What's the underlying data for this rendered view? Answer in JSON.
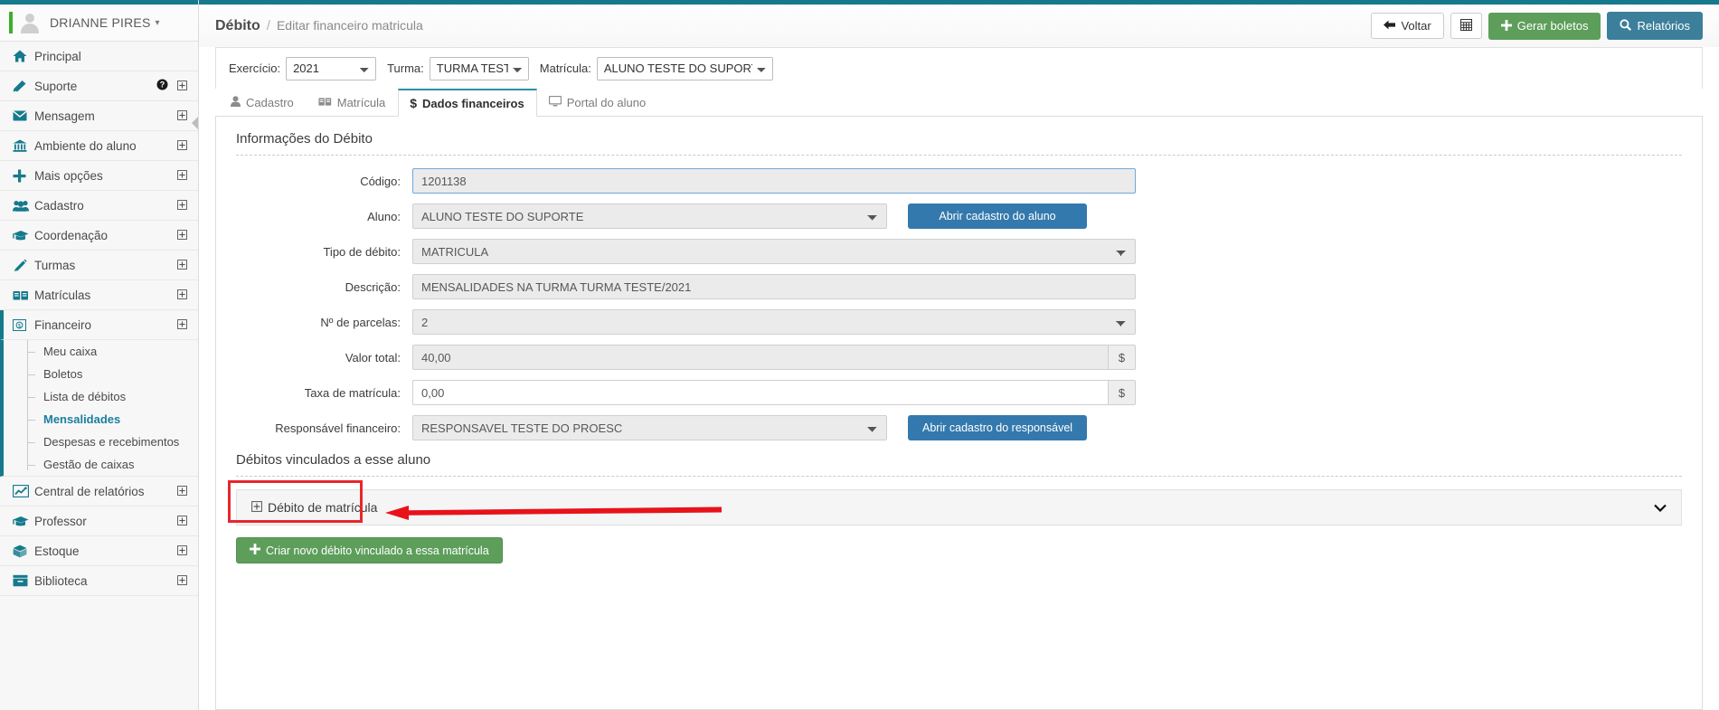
{
  "sidebar": {
    "user": {
      "name": "DRIANNE PIRES",
      "caret": "chevron-down"
    },
    "items": [
      {
        "label": "Principal",
        "icon": "home-icon",
        "expand": ""
      },
      {
        "label": "Suporte",
        "icon": "support-icon",
        "expand": "⊞",
        "help": "?"
      },
      {
        "label": "Mensagem",
        "icon": "envelope-icon",
        "expand": "⊞"
      },
      {
        "label": "Ambiente do aluno",
        "icon": "bank-icon",
        "expand": "⊞"
      },
      {
        "label": "Mais opções",
        "icon": "plus-icon",
        "expand": "⊞"
      },
      {
        "label": "Cadastro",
        "icon": "users-icon",
        "expand": "⊞"
      },
      {
        "label": "Coordenação",
        "icon": "graduation-icon",
        "expand": "⊞"
      },
      {
        "label": "Turmas",
        "icon": "pencil-icon",
        "expand": "⊞"
      },
      {
        "label": "Matrículas",
        "icon": "book-icon",
        "expand": "⊞"
      }
    ],
    "financeiro": {
      "label": "Financeiro",
      "icon": "money-circle-icon",
      "expand": "⊞"
    },
    "financeiro_sub": [
      {
        "label": "Meu caixa",
        "selected": false
      },
      {
        "label": "Boletos",
        "selected": false
      },
      {
        "label": "Lista de débitos",
        "selected": false
      },
      {
        "label": "Mensalidades",
        "selected": true
      },
      {
        "label": "Despesas e recebimentos",
        "selected": false
      },
      {
        "label": "Gestão de caixas",
        "selected": false
      }
    ],
    "items_after": [
      {
        "label": "Central de relatórios",
        "icon": "chart-icon",
        "expand": "⊞"
      },
      {
        "label": "Professor",
        "icon": "graduation-icon",
        "expand": "⊞"
      },
      {
        "label": "Estoque",
        "icon": "box-icon",
        "expand": "⊞"
      },
      {
        "label": "Biblioteca",
        "icon": "library-icon",
        "expand": "⊞"
      }
    ]
  },
  "header": {
    "breadcrumb_main": "Débito",
    "breadcrumb_sep": "/",
    "breadcrumb_sub": "Editar financeiro matricula",
    "buttons": {
      "voltar": "Voltar",
      "voltar_icon": "arrow-left-icon",
      "grid_icon": "grid-icon",
      "gerar_boletos": "Gerar boletos",
      "gerar_boletos_icon": "plus-icon",
      "relatorios": "Relatórios",
      "relatorios_icon": "search-icon"
    }
  },
  "filters": {
    "exercicio_label": "Exercício:",
    "exercicio_value": "2021",
    "turma_label": "Turma:",
    "turma_value": "TURMA TESTE",
    "matricula_label": "Matrícula:",
    "matricula_value": "ALUNO TESTE DO SUPORTE"
  },
  "tabs": [
    {
      "label": "Cadastro",
      "icon": "user-icon",
      "active": false
    },
    {
      "label": "Matrícula",
      "icon": "book-icon",
      "active": false
    },
    {
      "label": "Dados financeiros",
      "icon": "dollar-icon",
      "active": true
    },
    {
      "label": "Portal do aluno",
      "icon": "monitor-icon",
      "active": false
    }
  ],
  "form": {
    "section_title": "Informações do Débito",
    "fields": [
      {
        "label": "Código:",
        "value": "1201138"
      },
      {
        "label": "Aluno:",
        "value": "ALUNO TESTE DO SUPORTE"
      },
      {
        "label": "Tipo de débito:",
        "value": "MATRICULA"
      },
      {
        "label": "Descrição:",
        "value": "MENSALIDADES NA TURMA TURMA TESTE/2021"
      },
      {
        "label": "Nº de parcelas:",
        "value": "2"
      },
      {
        "label": "Valor total:",
        "value": "40,00"
      },
      {
        "label": "Taxa de matrícula:",
        "value": "0,00"
      },
      {
        "label": "Responsável financeiro:",
        "value": "RESPONSAVEL TESTE DO PROESC"
      }
    ],
    "money_addon": "$",
    "btn_abrir_aluno": "Abrir cadastro do aluno",
    "btn_abrir_responsavel": "Abrir cadastro do responsável"
  },
  "linked": {
    "section_title": "Débitos vinculados a esse aluno",
    "accordion_label": "Débito de matrícula",
    "accordion_expand_icon": "⊞",
    "accordion_chevron": "⌄",
    "create_button": "Criar novo débito vinculado a essa matrícula",
    "create_button_icon": "plus-icon"
  },
  "annotation": {
    "highlight_color": "#e8262c",
    "arrow_color": "#e8121a",
    "shape": "left-arrow"
  },
  "colors": {
    "brand_teal": "#157a8c",
    "accent_blue": "#3479ad",
    "green": "#5d9e5b",
    "tab_active_border": "#2d8fa8"
  }
}
